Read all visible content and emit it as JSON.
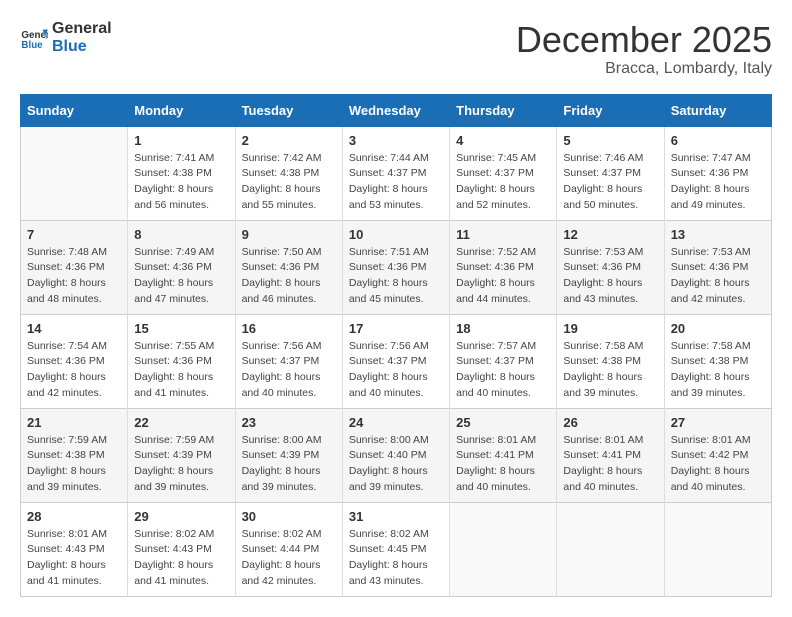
{
  "header": {
    "logo_general": "General",
    "logo_blue": "Blue",
    "month": "December 2025",
    "location": "Bracca, Lombardy, Italy"
  },
  "days_of_week": [
    "Sunday",
    "Monday",
    "Tuesday",
    "Wednesday",
    "Thursday",
    "Friday",
    "Saturday"
  ],
  "weeks": [
    [
      {
        "day": "",
        "info": ""
      },
      {
        "day": "1",
        "info": "Sunrise: 7:41 AM\nSunset: 4:38 PM\nDaylight: 8 hours\nand 56 minutes."
      },
      {
        "day": "2",
        "info": "Sunrise: 7:42 AM\nSunset: 4:38 PM\nDaylight: 8 hours\nand 55 minutes."
      },
      {
        "day": "3",
        "info": "Sunrise: 7:44 AM\nSunset: 4:37 PM\nDaylight: 8 hours\nand 53 minutes."
      },
      {
        "day": "4",
        "info": "Sunrise: 7:45 AM\nSunset: 4:37 PM\nDaylight: 8 hours\nand 52 minutes."
      },
      {
        "day": "5",
        "info": "Sunrise: 7:46 AM\nSunset: 4:37 PM\nDaylight: 8 hours\nand 50 minutes."
      },
      {
        "day": "6",
        "info": "Sunrise: 7:47 AM\nSunset: 4:36 PM\nDaylight: 8 hours\nand 49 minutes."
      }
    ],
    [
      {
        "day": "7",
        "info": "Sunrise: 7:48 AM\nSunset: 4:36 PM\nDaylight: 8 hours\nand 48 minutes."
      },
      {
        "day": "8",
        "info": "Sunrise: 7:49 AM\nSunset: 4:36 PM\nDaylight: 8 hours\nand 47 minutes."
      },
      {
        "day": "9",
        "info": "Sunrise: 7:50 AM\nSunset: 4:36 PM\nDaylight: 8 hours\nand 46 minutes."
      },
      {
        "day": "10",
        "info": "Sunrise: 7:51 AM\nSunset: 4:36 PM\nDaylight: 8 hours\nand 45 minutes."
      },
      {
        "day": "11",
        "info": "Sunrise: 7:52 AM\nSunset: 4:36 PM\nDaylight: 8 hours\nand 44 minutes."
      },
      {
        "day": "12",
        "info": "Sunrise: 7:53 AM\nSunset: 4:36 PM\nDaylight: 8 hours\nand 43 minutes."
      },
      {
        "day": "13",
        "info": "Sunrise: 7:53 AM\nSunset: 4:36 PM\nDaylight: 8 hours\nand 42 minutes."
      }
    ],
    [
      {
        "day": "14",
        "info": "Sunrise: 7:54 AM\nSunset: 4:36 PM\nDaylight: 8 hours\nand 42 minutes."
      },
      {
        "day": "15",
        "info": "Sunrise: 7:55 AM\nSunset: 4:36 PM\nDaylight: 8 hours\nand 41 minutes."
      },
      {
        "day": "16",
        "info": "Sunrise: 7:56 AM\nSunset: 4:37 PM\nDaylight: 8 hours\nand 40 minutes."
      },
      {
        "day": "17",
        "info": "Sunrise: 7:56 AM\nSunset: 4:37 PM\nDaylight: 8 hours\nand 40 minutes."
      },
      {
        "day": "18",
        "info": "Sunrise: 7:57 AM\nSunset: 4:37 PM\nDaylight: 8 hours\nand 40 minutes."
      },
      {
        "day": "19",
        "info": "Sunrise: 7:58 AM\nSunset: 4:38 PM\nDaylight: 8 hours\nand 39 minutes."
      },
      {
        "day": "20",
        "info": "Sunrise: 7:58 AM\nSunset: 4:38 PM\nDaylight: 8 hours\nand 39 minutes."
      }
    ],
    [
      {
        "day": "21",
        "info": "Sunrise: 7:59 AM\nSunset: 4:38 PM\nDaylight: 8 hours\nand 39 minutes."
      },
      {
        "day": "22",
        "info": "Sunrise: 7:59 AM\nSunset: 4:39 PM\nDaylight: 8 hours\nand 39 minutes."
      },
      {
        "day": "23",
        "info": "Sunrise: 8:00 AM\nSunset: 4:39 PM\nDaylight: 8 hours\nand 39 minutes."
      },
      {
        "day": "24",
        "info": "Sunrise: 8:00 AM\nSunset: 4:40 PM\nDaylight: 8 hours\nand 39 minutes."
      },
      {
        "day": "25",
        "info": "Sunrise: 8:01 AM\nSunset: 4:41 PM\nDaylight: 8 hours\nand 40 minutes."
      },
      {
        "day": "26",
        "info": "Sunrise: 8:01 AM\nSunset: 4:41 PM\nDaylight: 8 hours\nand 40 minutes."
      },
      {
        "day": "27",
        "info": "Sunrise: 8:01 AM\nSunset: 4:42 PM\nDaylight: 8 hours\nand 40 minutes."
      }
    ],
    [
      {
        "day": "28",
        "info": "Sunrise: 8:01 AM\nSunset: 4:43 PM\nDaylight: 8 hours\nand 41 minutes."
      },
      {
        "day": "29",
        "info": "Sunrise: 8:02 AM\nSunset: 4:43 PM\nDaylight: 8 hours\nand 41 minutes."
      },
      {
        "day": "30",
        "info": "Sunrise: 8:02 AM\nSunset: 4:44 PM\nDaylight: 8 hours\nand 42 minutes."
      },
      {
        "day": "31",
        "info": "Sunrise: 8:02 AM\nSunset: 4:45 PM\nDaylight: 8 hours\nand 43 minutes."
      },
      {
        "day": "",
        "info": ""
      },
      {
        "day": "",
        "info": ""
      },
      {
        "day": "",
        "info": ""
      }
    ]
  ]
}
